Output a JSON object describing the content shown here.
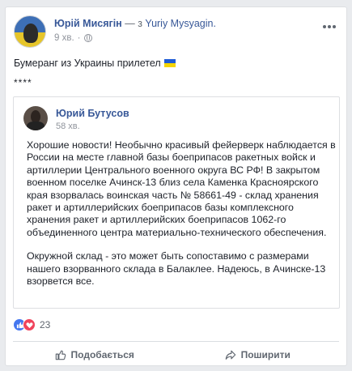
{
  "post": {
    "author": "Юрій Мисягін",
    "via_separator": "— з",
    "via_name": "Yuriy Mysyagin.",
    "time": "9 хв.",
    "text": "Бумеранг из Украины прилетел",
    "separator": "****"
  },
  "shared": {
    "author": "Юрий Бутусов",
    "time": "58 хв.",
    "paragraph1": "Хорошие новости! Необычно красивый фейерверк наблюдается в России на месте главной базы боеприпасов ракетных войск и артиллерии Центрального военного округа ВС РФ! В закрытом военном поселке Ачинск-13 близ села Каменка Красноярского края взорвалась воинская часть № 58661-49 - склад хранения ракет и артиллерийских боеприпасов базы комплексного хранения ракет и артиллерийских боеприпасов 1062-го объединенного центра материально-технического обеспечения.",
    "paragraph2": "Окружной склад - это может быть сопоставимо с размерами нашего взорванного склада в Балаклее. Надеюсь, в Ачинске-13 взорвется все."
  },
  "reactions": {
    "count": "23",
    "types": [
      "like-icon",
      "love-icon"
    ],
    "like_color": "#4477ef",
    "love_color": "#f0445c"
  },
  "actions": {
    "like_label": "Подобається",
    "share_label": "Поширити"
  },
  "colors": {
    "link": "#385898",
    "muted": "#90949c",
    "action_text": "#606770"
  }
}
